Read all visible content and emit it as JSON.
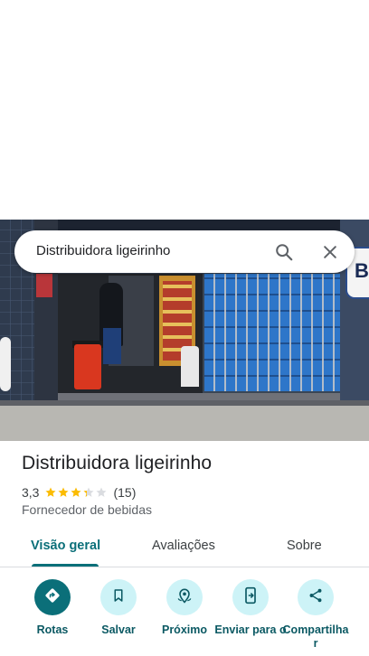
{
  "search": {
    "query": "Distribuidora ligeirinho"
  },
  "place": {
    "name": "Distribuidora ligeirinho",
    "rating": "3,3",
    "rating_value": 3.3,
    "rating_max": 5,
    "review_count": "(15)",
    "category": "Fornecedor de bebidas"
  },
  "tabs": [
    {
      "label": "Visão geral",
      "active": true
    },
    {
      "label": "Avaliações",
      "active": false
    },
    {
      "label": "Sobre",
      "active": false
    }
  ],
  "actions": [
    {
      "label": "Rotas",
      "icon": "directions-icon"
    },
    {
      "label": "Salvar",
      "icon": "bookmark-icon"
    },
    {
      "label": "Próximo",
      "icon": "nearby-icon"
    },
    {
      "label": "Enviar para o",
      "icon": "send-to-phone-icon"
    },
    {
      "label": "Compartilha r",
      "icon": "share-icon"
    }
  ],
  "colors": {
    "accent": "#0b6f79",
    "action_bg": "#cdf3f7",
    "star": "#fbbc04",
    "star_empty": "#dadce0"
  }
}
